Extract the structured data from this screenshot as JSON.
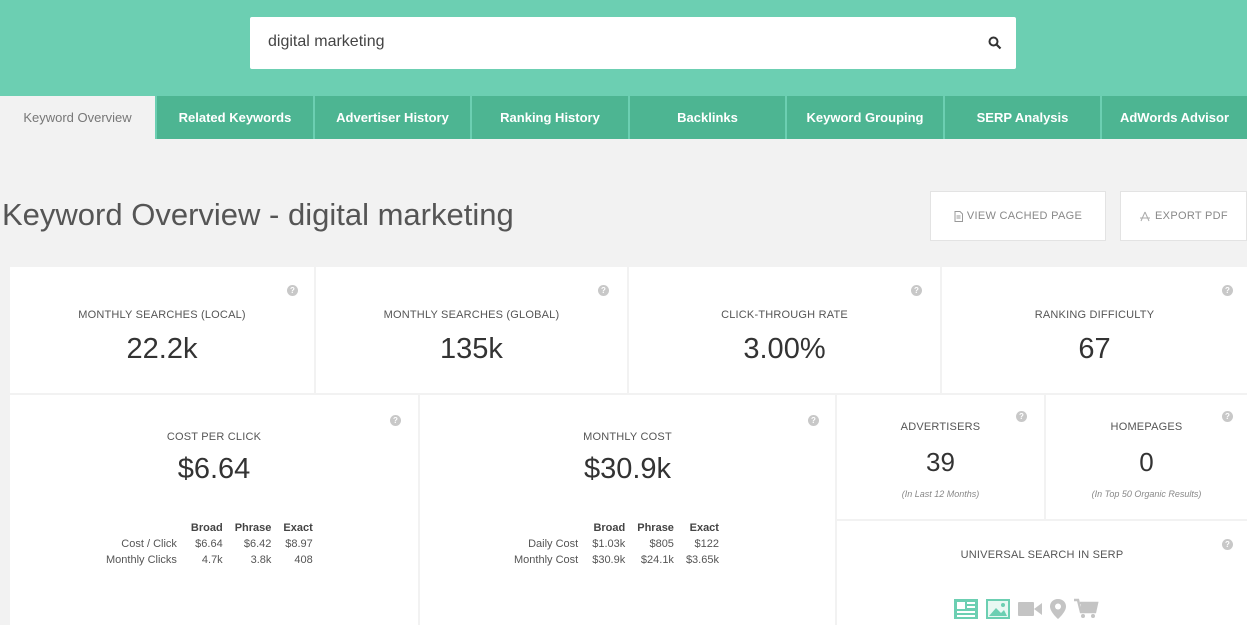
{
  "search": {
    "query": "digital marketing"
  },
  "tabs": [
    {
      "label": "Keyword Overview"
    },
    {
      "label": "Related Keywords"
    },
    {
      "label": "Advertiser History"
    },
    {
      "label": "Ranking History"
    },
    {
      "label": "Backlinks"
    },
    {
      "label": "Keyword Grouping"
    },
    {
      "label": "SERP Analysis"
    },
    {
      "label": "AdWords Advisor"
    }
  ],
  "page": {
    "title": "Keyword Overview - digital marketing",
    "view_cached_label": "VIEW CACHED PAGE",
    "export_pdf_label": "EXPORT PDF"
  },
  "metrics": {
    "monthly_local": {
      "label": "MONTHLY SEARCHES (LOCAL)",
      "value": "22.2k"
    },
    "monthly_global": {
      "label": "MONTHLY SEARCHES (GLOBAL)",
      "value": "135k"
    },
    "ctr": {
      "label": "CLICK-THROUGH RATE",
      "value": "3.00%"
    },
    "difficulty": {
      "label": "RANKING DIFFICULTY",
      "value": "67"
    },
    "cpc": {
      "label": "COST PER CLICK",
      "value": "$6.64",
      "headers": [
        "Broad",
        "Phrase",
        "Exact"
      ],
      "rows": [
        {
          "label": "Cost / Click",
          "broad": "$6.64",
          "phrase": "$6.42",
          "exact": "$8.97"
        },
        {
          "label": "Monthly Clicks",
          "broad": "4.7k",
          "phrase": "3.8k",
          "exact": "408"
        }
      ]
    },
    "monthly_cost": {
      "label": "MONTHLY COST",
      "value": "$30.9k",
      "headers": [
        "Broad",
        "Phrase",
        "Exact"
      ],
      "rows": [
        {
          "label": "Daily Cost",
          "broad": "$1.03k",
          "phrase": "$805",
          "exact": "$122"
        },
        {
          "label": "Monthly Cost",
          "broad": "$30.9k",
          "phrase": "$24.1k",
          "exact": "$3.65k"
        }
      ]
    },
    "advertisers": {
      "label": "ADVERTISERS",
      "value": "39",
      "sub": "(In Last 12 Months)"
    },
    "homepages": {
      "label": "HOMEPAGES",
      "value": "0",
      "sub": "(In Top 50 Organic Results)"
    },
    "universal": {
      "label": "UNIVERSAL SEARCH IN SERP",
      "icons": [
        "news-icon",
        "images-icon",
        "video-icon",
        "map-pin-icon",
        "shopping-cart-icon"
      ]
    }
  },
  "colors": {
    "header": "#6ccfb2",
    "tab": "#4db592",
    "accent_icon": "#6ccfb2",
    "inactive_icon": "#c4c4c4"
  }
}
